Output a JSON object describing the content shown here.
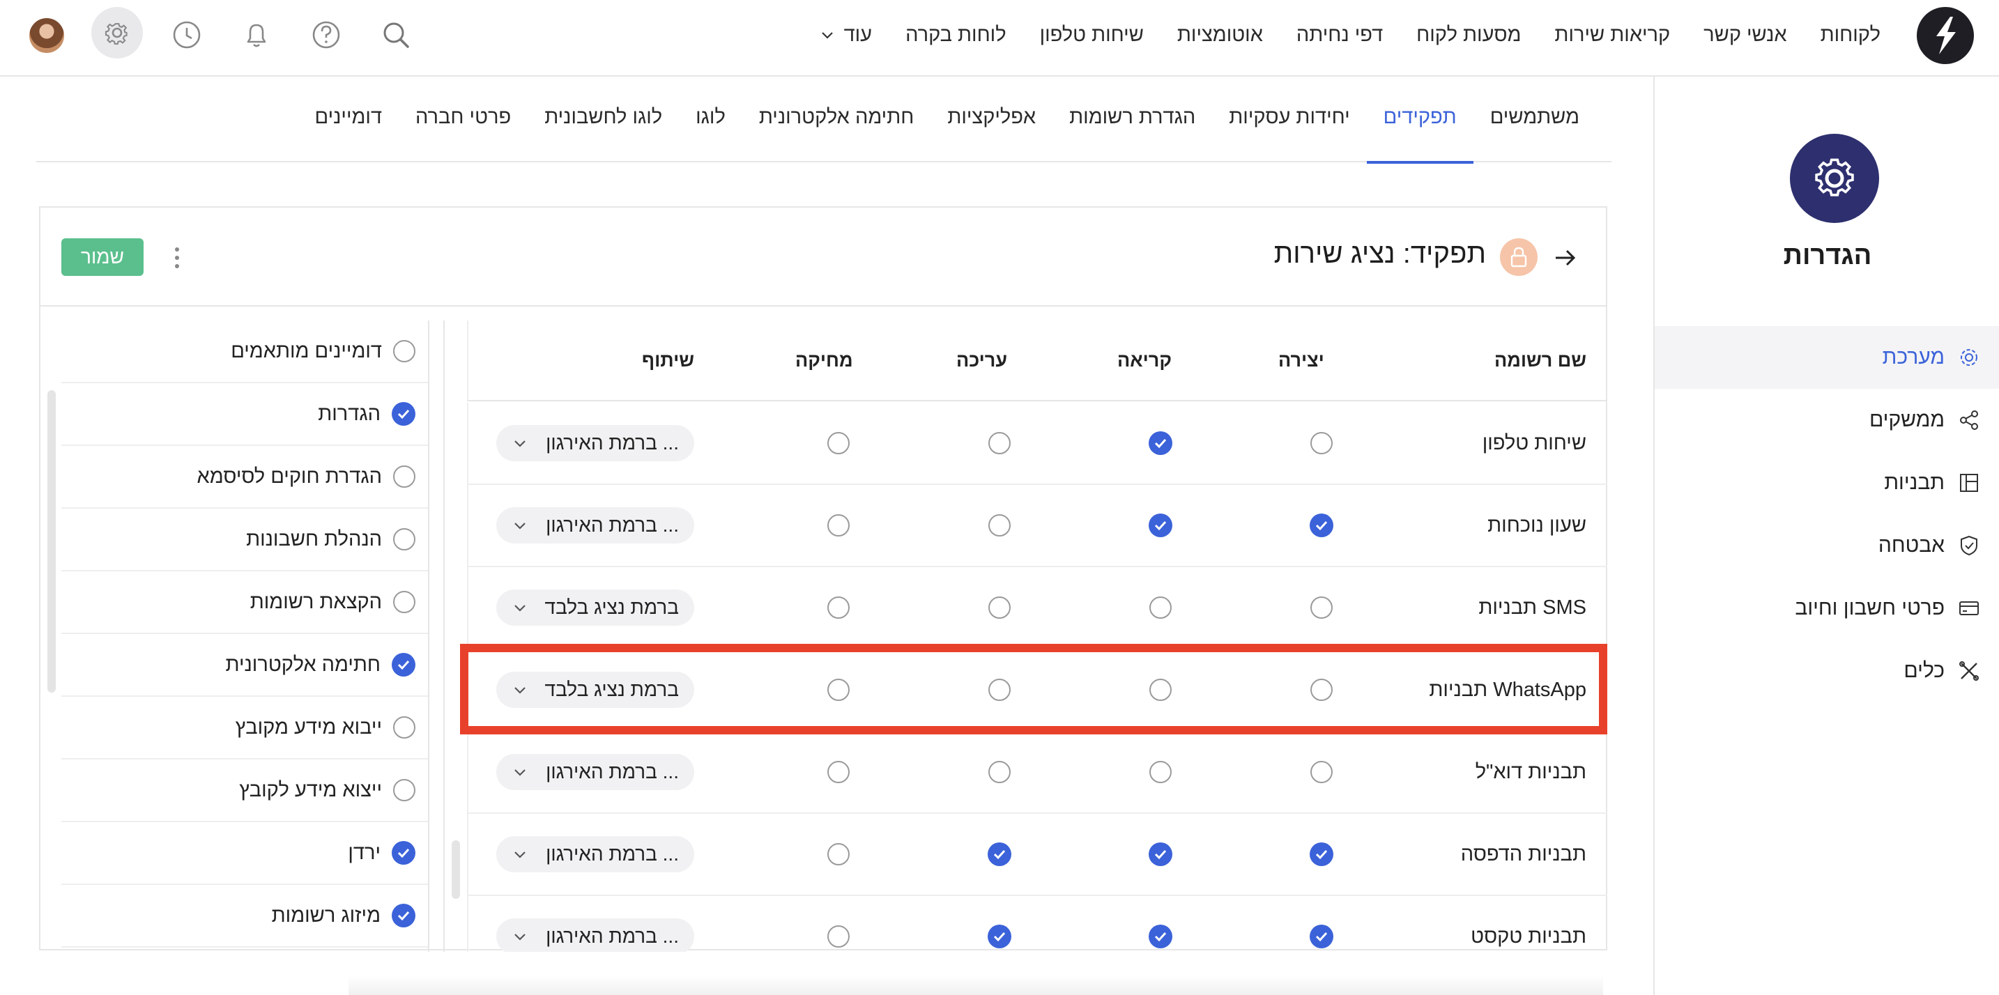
{
  "topbar": {
    "nav_items": [
      "לקוחות",
      "אנשי קשר",
      "קריאות שירות",
      "מסעות לקוח",
      "דפי נחיתה",
      "אוטומציות",
      "שיחות טלפון",
      "לוחות בקרה"
    ],
    "more_label": "עוד",
    "icons": [
      "search-icon",
      "help-icon",
      "bell-icon",
      "history-icon",
      "gear-icon",
      "avatar"
    ]
  },
  "sidebar": {
    "title": "הגדרות",
    "items": [
      {
        "label": "מערכת",
        "icon": "gear-icon",
        "active": true
      },
      {
        "label": "ממשקים",
        "icon": "share-icon"
      },
      {
        "label": "תבניות",
        "icon": "layout-icon"
      },
      {
        "label": "אבטחה",
        "icon": "shield-icon"
      },
      {
        "label": "פרטי חשבון וחיוב",
        "icon": "card-icon"
      },
      {
        "label": "כלים",
        "icon": "tools-icon"
      }
    ]
  },
  "tabs": [
    "משתמשים",
    "תפקידים",
    "יחידות עסקיות",
    "הגדרת רשומות",
    "אפליקציות",
    "חתימה אלקטרונית",
    "לוגו",
    "לוגו לחשבונית",
    "פרטי חברה",
    "דומיינים"
  ],
  "active_tab": "תפקידים",
  "role": {
    "title": "תפקיד: נציג שירות",
    "save_label": "שמור"
  },
  "permissions": [
    {
      "label": "דומיינים מותאמים",
      "checked": false
    },
    {
      "label": "הגדרות",
      "checked": true
    },
    {
      "label": "הגדרת חוקים לסיסמא",
      "checked": false
    },
    {
      "label": "הנהלת חשבונות",
      "checked": false
    },
    {
      "label": "הקצאת רשומות",
      "checked": false
    },
    {
      "label": "חתימה אלקטרונית",
      "checked": true
    },
    {
      "label": "ייבוא מידע מקובץ",
      "checked": false
    },
    {
      "label": "ייצוא מידע לקובץ",
      "checked": false
    },
    {
      "label": "ירדן",
      "checked": true
    },
    {
      "label": "מיזוג רשומות",
      "checked": true
    }
  ],
  "table": {
    "headers": {
      "name": "שם רשומה",
      "create": "יצירה",
      "read": "קריאה",
      "edit": "עריכה",
      "delete": "מחיקה",
      "share": "שיתוף"
    },
    "rows": [
      {
        "name": "שיחות טלפון",
        "create": false,
        "read": true,
        "edit": false,
        "delete": false,
        "share": "ברמת האירגון ..."
      },
      {
        "name": "שעון נוכחות",
        "create": true,
        "read": true,
        "edit": false,
        "delete": false,
        "share": "ברמת האירגון ..."
      },
      {
        "name": "תבניות SMS",
        "create": false,
        "read": false,
        "edit": false,
        "delete": false,
        "share": "ברמת נציג בלבד"
      },
      {
        "name": "תבניות WhatsApp",
        "create": false,
        "read": false,
        "edit": false,
        "delete": false,
        "share": "ברמת נציג בלבד"
      },
      {
        "name": "תבניות דוא\"ל",
        "create": false,
        "read": false,
        "edit": false,
        "delete": false,
        "share": "ברמת האירגון ..."
      },
      {
        "name": "תבניות הדפסה",
        "create": true,
        "read": true,
        "edit": true,
        "delete": false,
        "share": "ברמת האירגון ..."
      },
      {
        "name": "תבניות טקסט",
        "create": true,
        "read": true,
        "edit": true,
        "delete": false,
        "share": "ברמת האירגון ..."
      }
    ]
  },
  "colors": {
    "accent": "#3b62d9",
    "save": "#5bbf8d",
    "highlight": "#e8412b",
    "settings_circle": "#2d2f6e"
  }
}
